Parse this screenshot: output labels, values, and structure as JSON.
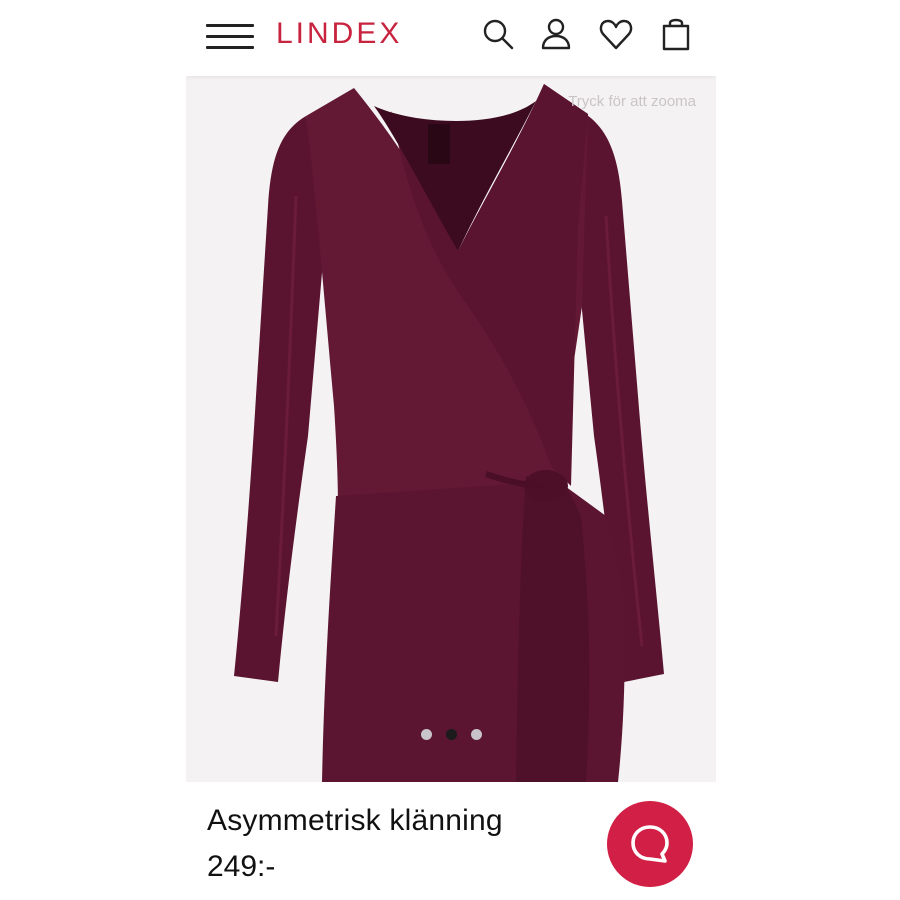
{
  "header": {
    "logo_text": "LINDEX",
    "menu_icon": "hamburger-menu-icon",
    "icons": [
      "search-icon",
      "account-icon",
      "heart-icon",
      "shopping-bag-icon"
    ],
    "brand_color": "#c8233f"
  },
  "gallery": {
    "zoom_hint": "Tryck för att zooma",
    "dot_count": 3,
    "active_dot": 2
  },
  "product": {
    "name": "Asymmetrisk klänning",
    "price": "249:-",
    "dress_color": "#5e1530"
  },
  "chat": {
    "icon": "chat-bubble-icon",
    "color": "#d21f45"
  }
}
